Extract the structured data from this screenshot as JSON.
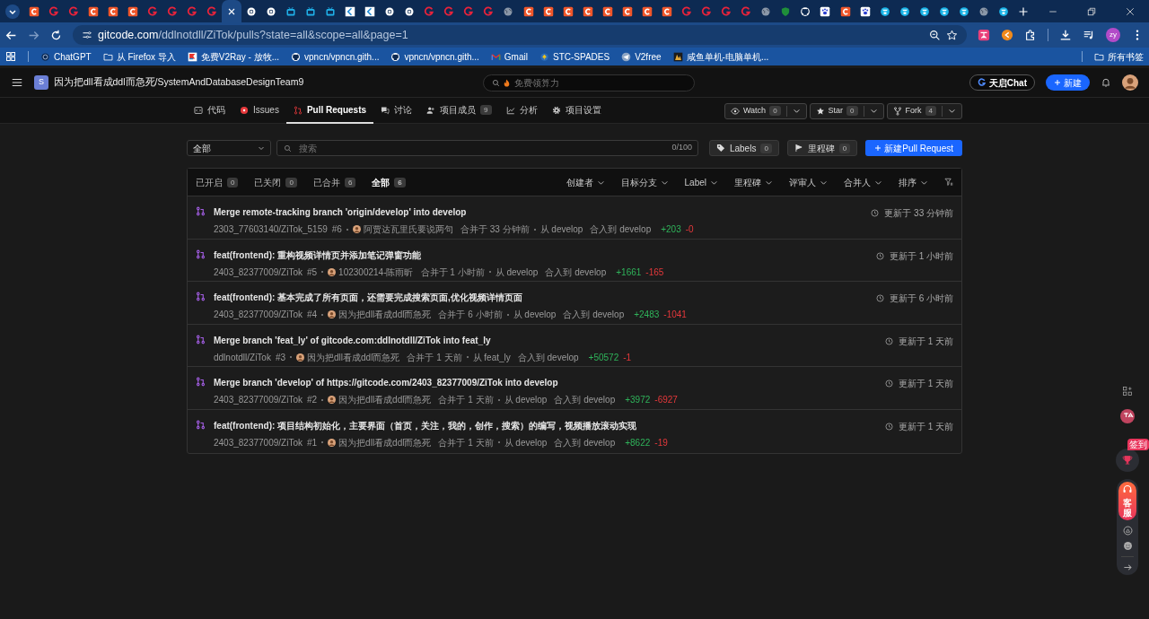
{
  "browser": {
    "tabs": [
      {
        "kind": "c",
        "selected": false
      },
      {
        "kind": "g",
        "selected": false
      },
      {
        "kind": "g",
        "selected": false
      },
      {
        "kind": "c",
        "selected": false
      },
      {
        "kind": "c",
        "selected": false
      },
      {
        "kind": "c",
        "selected": false
      },
      {
        "kind": "g",
        "selected": false
      },
      {
        "kind": "g",
        "selected": false
      },
      {
        "kind": "g",
        "selected": false
      },
      {
        "kind": "g",
        "selected": false
      },
      {
        "selected": true
      },
      {
        "kind": "ring",
        "selected": false
      },
      {
        "kind": "ring",
        "selected": false
      },
      {
        "kind": "tv",
        "selected": false
      },
      {
        "kind": "tv",
        "selected": false
      },
      {
        "kind": "tv",
        "selected": false
      },
      {
        "kind": "chevron",
        "selected": false
      },
      {
        "kind": "chevron",
        "selected": false
      },
      {
        "kind": "ring",
        "selected": false
      },
      {
        "kind": "ring",
        "selected": false
      },
      {
        "kind": "g",
        "selected": false
      },
      {
        "kind": "g",
        "selected": false
      },
      {
        "kind": "g",
        "selected": false
      },
      {
        "kind": "g",
        "selected": false
      },
      {
        "kind": "globe",
        "selected": false
      },
      {
        "kind": "c",
        "selected": false
      },
      {
        "kind": "c",
        "selected": false
      },
      {
        "kind": "c",
        "selected": false
      },
      {
        "kind": "c",
        "selected": false
      },
      {
        "kind": "c",
        "selected": false
      },
      {
        "kind": "c",
        "selected": false
      },
      {
        "kind": "c",
        "selected": false
      },
      {
        "kind": "c",
        "selected": false
      },
      {
        "kind": "g",
        "selected": false
      },
      {
        "kind": "g",
        "selected": false
      },
      {
        "kind": "g",
        "selected": false
      },
      {
        "kind": "g",
        "selected": false
      },
      {
        "kind": "globe",
        "selected": false
      },
      {
        "kind": "shield",
        "selected": false
      },
      {
        "kind": "cat",
        "selected": false
      },
      {
        "kind": "paw",
        "selected": false
      },
      {
        "kind": "c",
        "selected": false
      },
      {
        "kind": "paw",
        "selected": false
      },
      {
        "kind": "bull",
        "selected": false
      },
      {
        "kind": "bull",
        "selected": false
      },
      {
        "kind": "bull",
        "selected": false
      },
      {
        "kind": "bull",
        "selected": false
      },
      {
        "kind": "bull",
        "selected": false
      },
      {
        "kind": "globe",
        "selected": false
      },
      {
        "kind": "bull",
        "selected": false
      }
    ],
    "address": {
      "host": "gitcode.com",
      "path": "/ddlnotdll/ZiTok/pulls?state=all&scope=all&page=1"
    },
    "profile": "zy",
    "bookmarks": [
      {
        "label": "ChatGPT",
        "kind": "knot"
      },
      {
        "label": "从 Firefox 导入",
        "kind": "folder"
      },
      {
        "label": "免费V2Ray - 放牧...",
        "kind": "flag"
      },
      {
        "label": "vpncn/vpncn.gith...",
        "kind": "cat"
      },
      {
        "label": "vpncn/vpncn.gith...",
        "kind": "cat"
      },
      {
        "label": "Gmail",
        "kind": "mail"
      },
      {
        "label": "STC-SPADES",
        "kind": "spade"
      },
      {
        "label": "V2free",
        "kind": "plane"
      },
      {
        "label": "咸鱼单机-电脑单机...",
        "kind": "game"
      }
    ],
    "all_bookmarks": "所有书签"
  },
  "header": {
    "repo_initial": "S",
    "repo_path": "因为把dll看成ddl而急死/SystemAndDatabaseDesignTeam9",
    "search_placeholder": "免费领算力",
    "chat_button": "天启Chat",
    "new_button": "新建"
  },
  "repo_tabs": [
    {
      "label": "代码",
      "kind": "code",
      "selected": false
    },
    {
      "label": "Issues",
      "kind": "issue",
      "selected": false
    },
    {
      "label": "Pull Requests",
      "kind": "pr",
      "selected": true
    },
    {
      "label": "讨论",
      "kind": "chat",
      "selected": false
    },
    {
      "label": "项目成员",
      "kind": "people",
      "count": "9",
      "selected": false
    },
    {
      "label": "分析",
      "kind": "chart",
      "selected": false
    },
    {
      "label": "项目设置",
      "kind": "gear",
      "selected": false
    }
  ],
  "repo_actions": [
    {
      "label": "Watch",
      "kind": "eye",
      "count": "0"
    },
    {
      "label": "Star",
      "kind": "star",
      "count": "0"
    },
    {
      "label": "Fork",
      "kind": "fork",
      "count": "4"
    }
  ],
  "toolbar": {
    "scope": "全部",
    "search_placeholder": "搜索",
    "counter": "0/100",
    "labels": {
      "label": "Labels",
      "count": "0"
    },
    "milestones": {
      "label": "里程碑",
      "count": "0"
    },
    "new_button": "新建Pull Request"
  },
  "state_tabs": [
    {
      "label": "已开启",
      "count": "0",
      "selected": false
    },
    {
      "label": "已关闭",
      "count": "0",
      "selected": false
    },
    {
      "label": "已合并",
      "count": "6",
      "selected": false
    },
    {
      "label": "全部",
      "count": "6",
      "selected": true
    }
  ],
  "filters": [
    "创建者",
    "目标分支",
    "Label",
    "里程碑",
    "评审人",
    "合并人",
    "排序"
  ],
  "pull_requests": [
    {
      "title": "Merge remote-tracking branch 'origin/develop' into develop",
      "repo": "2303_77603140/ZiTok_5159",
      "number": "#6",
      "author": "阿贾达瓦里氏要说两句",
      "merged": "合并于 33 分钟前",
      "source": "从 develop",
      "target": "合入到 develop",
      "additions": "+203",
      "deletions": "-0",
      "updated": "更新于 33 分钟前"
    },
    {
      "title": "feat(frontend): 重构视频详情页并添加笔记弹窗功能",
      "repo": "2403_82377009/ZiTok",
      "number": "#5",
      "author": "102300214-陈雨昕",
      "merged": "合并于 1 小时前",
      "source": "从 develop",
      "target": "合入到 develop",
      "additions": "+1661",
      "deletions": "-165",
      "updated": "更新于 1 小时前"
    },
    {
      "title": "feat(frontend): 基本完成了所有页面，还需要完成搜索页面,优化视频详情页面",
      "repo": "2403_82377009/ZiTok",
      "number": "#4",
      "author": "因为把dll看成ddl而急死",
      "merged": "合并于 6 小时前",
      "source": "从 develop",
      "target": "合入到 develop",
      "additions": "+2483",
      "deletions": "-1041",
      "updated": "更新于 6 小时前"
    },
    {
      "title": "Merge branch 'feat_ly' of gitcode.com:ddlnotdll/ZiTok into feat_ly",
      "repo": "ddlnotdll/ZiTok",
      "number": "#3",
      "author": "因为把dll看成ddl而急死",
      "merged": "合并于 1 天前",
      "source": "从 feat_ly",
      "target": "合入到 develop",
      "additions": "+50572",
      "deletions": "-1",
      "updated": "更新于 1 天前"
    },
    {
      "title": "Merge branch 'develop' of https://gitcode.com/2403_82377009/ZiTok into develop",
      "repo": "2403_82377009/ZiTok",
      "number": "#2",
      "author": "因为把dll看成ddl而急死",
      "merged": "合并于 1 天前",
      "source": "从 develop",
      "target": "合入到 develop",
      "additions": "+3972",
      "deletions": "-6927",
      "updated": "更新于 1 天前"
    },
    {
      "title": "feat(frontend): 项目结构初始化，主要界面（首页，关注，我的，创作，搜索）的编写，视频播放滚动实现",
      "repo": "2403_82377009/ZiTok",
      "number": "#1",
      "author": "因为把dll看成ddl而急死",
      "merged": "合并于 1 天前",
      "source": "从 develop",
      "target": "合入到 develop",
      "additions": "+8622",
      "deletions": "-19",
      "updated": "更新于 1 天前"
    }
  ],
  "side_widgets": {
    "checkin_badge": "签到",
    "service": "客服"
  }
}
